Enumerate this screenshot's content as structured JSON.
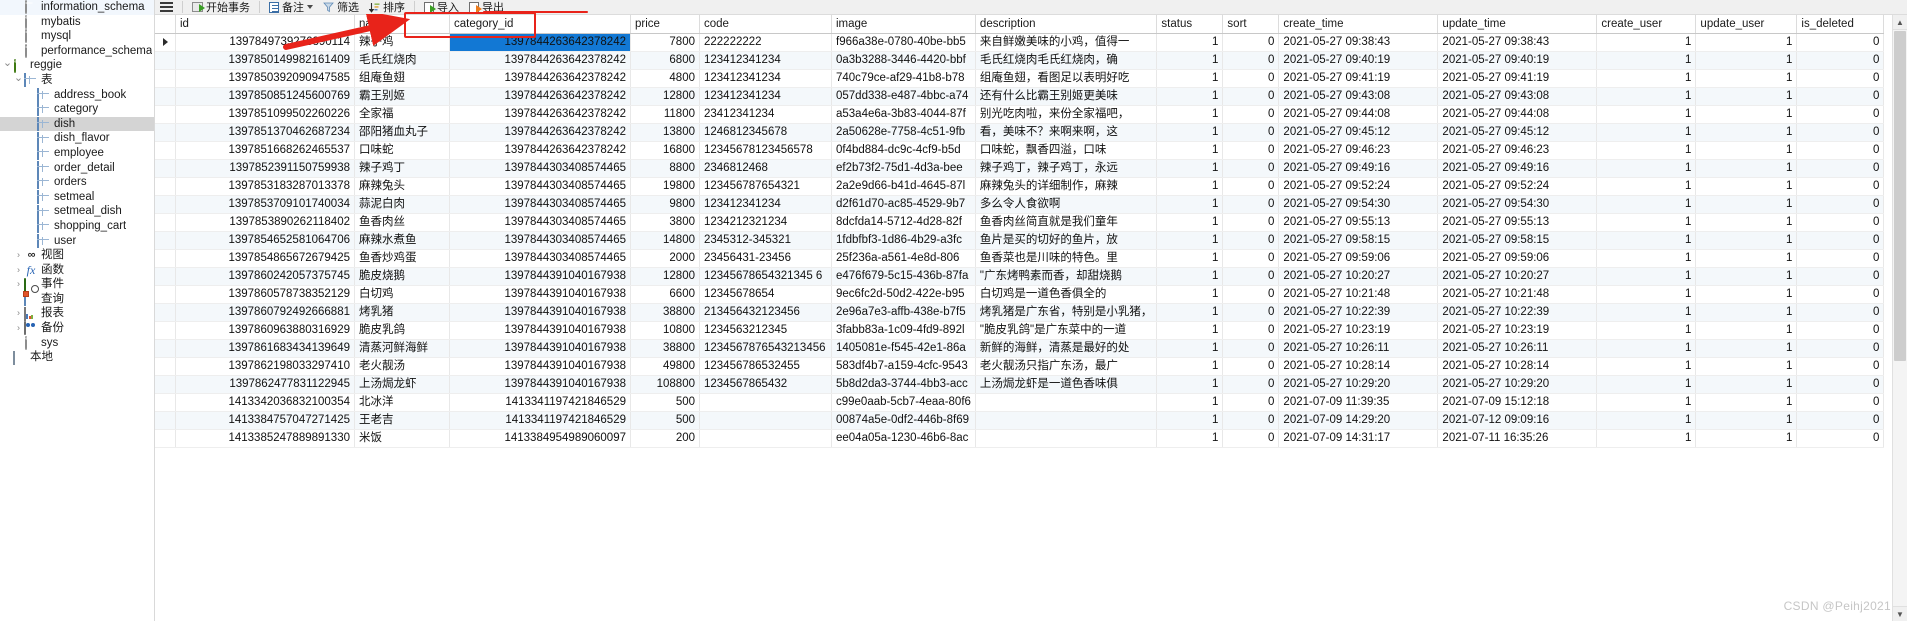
{
  "sidebar": {
    "items": [
      {
        "label": "information_schema",
        "icon": "database-icon",
        "indent": 1,
        "twisty": "",
        "selected": false
      },
      {
        "label": "mybatis",
        "icon": "database-icon",
        "indent": 1,
        "twisty": "",
        "selected": false
      },
      {
        "label": "mysql",
        "icon": "database-icon",
        "indent": 1,
        "twisty": "",
        "selected": false
      },
      {
        "label": "performance_schema",
        "icon": "database-icon",
        "indent": 1,
        "twisty": "",
        "selected": false
      },
      {
        "label": "reggie",
        "icon": "database-green-icon",
        "indent": 0,
        "twisty": "expanded",
        "selected": false
      },
      {
        "label": "表",
        "icon": "table-group-icon",
        "indent": 1,
        "twisty": "expanded",
        "selected": false
      },
      {
        "label": "address_book",
        "icon": "table-icon",
        "indent": 2,
        "twisty": "",
        "selected": false
      },
      {
        "label": "category",
        "icon": "table-icon",
        "indent": 2,
        "twisty": "",
        "selected": false
      },
      {
        "label": "dish",
        "icon": "table-icon",
        "indent": 2,
        "twisty": "",
        "selected": true
      },
      {
        "label": "dish_flavor",
        "icon": "table-icon",
        "indent": 2,
        "twisty": "",
        "selected": false
      },
      {
        "label": "employee",
        "icon": "table-icon",
        "indent": 2,
        "twisty": "",
        "selected": false
      },
      {
        "label": "order_detail",
        "icon": "table-icon",
        "indent": 2,
        "twisty": "",
        "selected": false
      },
      {
        "label": "orders",
        "icon": "table-icon",
        "indent": 2,
        "twisty": "",
        "selected": false
      },
      {
        "label": "setmeal",
        "icon": "table-icon",
        "indent": 2,
        "twisty": "",
        "selected": false
      },
      {
        "label": "setmeal_dish",
        "icon": "table-icon",
        "indent": 2,
        "twisty": "",
        "selected": false
      },
      {
        "label": "shopping_cart",
        "icon": "table-icon",
        "indent": 2,
        "twisty": "",
        "selected": false
      },
      {
        "label": "user",
        "icon": "table-icon",
        "indent": 2,
        "twisty": "",
        "selected": false
      },
      {
        "label": "视图",
        "icon": "view-icon",
        "indent": 1,
        "twisty": "collapsed",
        "selected": false
      },
      {
        "label": "函数",
        "icon": "function-icon",
        "indent": 1,
        "twisty": "collapsed",
        "selected": false
      },
      {
        "label": "事件",
        "icon": "event-icon",
        "indent": 1,
        "twisty": "collapsed",
        "selected": false
      },
      {
        "label": "查询",
        "icon": "query-icon",
        "indent": 1,
        "twisty": "",
        "selected": false
      },
      {
        "label": "报表",
        "icon": "report-icon",
        "indent": 1,
        "twisty": "collapsed",
        "selected": false
      },
      {
        "label": "备份",
        "icon": "backup-icon",
        "indent": 1,
        "twisty": "collapsed",
        "selected": false
      },
      {
        "label": "sys",
        "icon": "database-icon",
        "indent": 1,
        "twisty": "",
        "selected": false
      },
      {
        "label": "本地",
        "icon": "local-icon",
        "indent": 0,
        "twisty": "",
        "selected": false
      }
    ]
  },
  "toolbar": {
    "menu_icon": "hamburger-icon",
    "buttons": [
      {
        "label": "开始事务",
        "icon": "begin-transaction-icon",
        "caret": false
      },
      {
        "label": "备注",
        "icon": "note-icon",
        "caret": true
      },
      {
        "label": "筛选",
        "icon": "filter-icon",
        "caret": false
      },
      {
        "label": "排序",
        "icon": "sort-icon",
        "caret": false
      },
      {
        "label": "导入",
        "icon": "import-icon",
        "caret": false
      },
      {
        "label": "导出",
        "icon": "export-icon",
        "caret": false
      }
    ]
  },
  "grid": {
    "columns": [
      "id",
      "name",
      "category_id",
      "price",
      "code",
      "image",
      "description",
      "status",
      "sort",
      "create_time",
      "update_time",
      "create_user",
      "update_user",
      "is_deleted"
    ],
    "highlighted_column": "category_id",
    "selected_cell": {
      "row": 0,
      "column": "category_id"
    },
    "rows": [
      {
        "id": "1397849739276890114",
        "name": "辣子鸡",
        "category_id": "1397844263642378242",
        "price": "7800",
        "code": "222222222",
        "image": "f966a38e-0780-40be-bb5",
        "description": "来自鲜嫩美味的小鸡，值得一",
        "status": "1",
        "sort": "0",
        "create_time": "2021-05-27 09:38:43",
        "update_time": "2021-05-27 09:38:43",
        "create_user": "1",
        "update_user": "1",
        "is_deleted": "0"
      },
      {
        "id": "1397850149982161409",
        "name": "毛氏红烧肉",
        "category_id": "1397844263642378242",
        "price": "6800",
        "code": "123412341234",
        "image": "0a3b3288-3446-4420-bbf",
        "description": "毛氏红烧肉毛氏红烧肉，确",
        "status": "1",
        "sort": "0",
        "create_time": "2021-05-27 09:40:19",
        "update_time": "2021-05-27 09:40:19",
        "create_user": "1",
        "update_user": "1",
        "is_deleted": "0"
      },
      {
        "id": "1397850392090947585",
        "name": "组庵鱼翅",
        "category_id": "1397844263642378242",
        "price": "4800",
        "code": "123412341234",
        "image": "740c79ce-af29-41b8-b78",
        "description": "组庵鱼翅，看图足以表明好吃",
        "status": "1",
        "sort": "0",
        "create_time": "2021-05-27 09:41:19",
        "update_time": "2021-05-27 09:41:19",
        "create_user": "1",
        "update_user": "1",
        "is_deleted": "0"
      },
      {
        "id": "1397850851245600769",
        "name": "霸王别姬",
        "category_id": "1397844263642378242",
        "price": "12800",
        "code": "123412341234",
        "image": "057dd338-e487-4bbc-a74",
        "description": "还有什么比霸王别姬更美味",
        "status": "1",
        "sort": "0",
        "create_time": "2021-05-27 09:43:08",
        "update_time": "2021-05-27 09:43:08",
        "create_user": "1",
        "update_user": "1",
        "is_deleted": "0"
      },
      {
        "id": "1397851099502260226",
        "name": "全家福",
        "category_id": "1397844263642378242",
        "price": "11800",
        "code": "23412341234",
        "image": "a53a4e6a-3b83-4044-87f",
        "description": "别光吃肉啦，来份全家福吧，",
        "status": "1",
        "sort": "0",
        "create_time": "2021-05-27 09:44:08",
        "update_time": "2021-05-27 09:44:08",
        "create_user": "1",
        "update_user": "1",
        "is_deleted": "0"
      },
      {
        "id": "1397851370462687234",
        "name": "邵阳猪血丸子",
        "category_id": "1397844263642378242",
        "price": "13800",
        "code": "1246812345678",
        "image": "2a50628e-7758-4c51-9fb",
        "description": "看，美味不？来啊来啊，这",
        "status": "1",
        "sort": "0",
        "create_time": "2021-05-27 09:45:12",
        "update_time": "2021-05-27 09:45:12",
        "create_user": "1",
        "update_user": "1",
        "is_deleted": "0"
      },
      {
        "id": "1397851668262465537",
        "name": "口味蛇",
        "category_id": "1397844263642378242",
        "price": "16800",
        "code": "12345678123456578",
        "image": "0f4bd884-dc9c-4cf9-b5d",
        "description": "口味蛇，飘香四溢，口味",
        "status": "1",
        "sort": "0",
        "create_time": "2021-05-27 09:46:23",
        "update_time": "2021-05-27 09:46:23",
        "create_user": "1",
        "update_user": "1",
        "is_deleted": "0"
      },
      {
        "id": "1397852391150759938",
        "name": "辣子鸡丁",
        "category_id": "1397844303408574465",
        "price": "8800",
        "code": "2346812468",
        "image": "ef2b73f2-75d1-4d3a-bee",
        "description": "辣子鸡丁，辣子鸡丁，永远",
        "status": "1",
        "sort": "0",
        "create_time": "2021-05-27 09:49:16",
        "update_time": "2021-05-27 09:49:16",
        "create_user": "1",
        "update_user": "1",
        "is_deleted": "0"
      },
      {
        "id": "1397853183287013378",
        "name": "麻辣兔头",
        "category_id": "1397844303408574465",
        "price": "19800",
        "code": "123456787654321",
        "image": "2a2e9d66-b41d-4645-87l",
        "description": "麻辣兔头的详细制作，麻辣",
        "status": "1",
        "sort": "0",
        "create_time": "2021-05-27 09:52:24",
        "update_time": "2021-05-27 09:52:24",
        "create_user": "1",
        "update_user": "1",
        "is_deleted": "0"
      },
      {
        "id": "1397853709101740034",
        "name": "蒜泥白肉",
        "category_id": "1397844303408574465",
        "price": "9800",
        "code": "123412341234",
        "image": "d2f61d70-ac85-4529-9b7",
        "description": "多么令人食欲啊",
        "status": "1",
        "sort": "0",
        "create_time": "2021-05-27 09:54:30",
        "update_time": "2021-05-27 09:54:30",
        "create_user": "1",
        "update_user": "1",
        "is_deleted": "0"
      },
      {
        "id": "1397853890262118402",
        "name": "鱼香肉丝",
        "category_id": "1397844303408574465",
        "price": "3800",
        "code": "1234212321234",
        "image": "8dcfda14-5712-4d28-82f",
        "description": "鱼香肉丝简直就是我们童年",
        "status": "1",
        "sort": "0",
        "create_time": "2021-05-27 09:55:13",
        "update_time": "2021-05-27 09:55:13",
        "create_user": "1",
        "update_user": "1",
        "is_deleted": "0"
      },
      {
        "id": "1397854652581064706",
        "name": "麻辣水煮鱼",
        "category_id": "1397844303408574465",
        "price": "14800",
        "code": "2345312-345321",
        "image": "1fdbfbf3-1d86-4b29-a3fc",
        "description": "鱼片是买的切好的鱼片，放",
        "status": "1",
        "sort": "0",
        "create_time": "2021-05-27 09:58:15",
        "update_time": "2021-05-27 09:58:15",
        "create_user": "1",
        "update_user": "1",
        "is_deleted": "0"
      },
      {
        "id": "1397854865672679425",
        "name": "鱼香炒鸡蛋",
        "category_id": "1397844303408574465",
        "price": "2000",
        "code": "23456431-23456",
        "image": "25f236a-a561-4e8d-806",
        "description": "鱼香菜也是川味的特色。里",
        "status": "1",
        "sort": "0",
        "create_time": "2021-05-27 09:59:06",
        "update_time": "2021-05-27 09:59:06",
        "create_user": "1",
        "update_user": "1",
        "is_deleted": "0"
      },
      {
        "id": "1397860242057375745",
        "name": "脆皮烧鹅",
        "category_id": "1397844391040167938",
        "price": "12800",
        "code": "12345678654321345 6",
        "image": "e476f679-5c15-436b-87fa",
        "description": "\"广东烤鸭素而香，却甜烧鹅",
        "status": "1",
        "sort": "0",
        "create_time": "2021-05-27 10:20:27",
        "update_time": "2021-05-27 10:20:27",
        "create_user": "1",
        "update_user": "1",
        "is_deleted": "0"
      },
      {
        "id": "1397860578738352129",
        "name": "白切鸡",
        "category_id": "1397844391040167938",
        "price": "6600",
        "code": "12345678654",
        "image": "9ec6fc2d-50d2-422e-b95",
        "description": "白切鸡是一道色香俱全的",
        "status": "1",
        "sort": "0",
        "create_time": "2021-05-27 10:21:48",
        "update_time": "2021-05-27 10:21:48",
        "create_user": "1",
        "update_user": "1",
        "is_deleted": "0"
      },
      {
        "id": "1397860792492666881",
        "name": "烤乳猪",
        "category_id": "1397844391040167938",
        "price": "38800",
        "code": "213456432123456",
        "image": "2e96a7e3-affb-438e-b7f5",
        "description": "烤乳猪是广东省，特别是小乳猪，",
        "status": "1",
        "sort": "0",
        "create_time": "2021-05-27 10:22:39",
        "update_time": "2021-05-27 10:22:39",
        "create_user": "1",
        "update_user": "1",
        "is_deleted": "0"
      },
      {
        "id": "1397860963880316929",
        "name": "脆皮乳鸽",
        "category_id": "1397844391040167938",
        "price": "10800",
        "code": "1234563212345",
        "image": "3fabb83a-1c09-4fd9-892l",
        "description": "\"脆皮乳鸽\"是广东菜中的一道",
        "status": "1",
        "sort": "0",
        "create_time": "2021-05-27 10:23:19",
        "update_time": "2021-05-27 10:23:19",
        "create_user": "1",
        "update_user": "1",
        "is_deleted": "0"
      },
      {
        "id": "1397861683434139649",
        "name": "清蒸河鲜海鲜",
        "category_id": "1397844391040167938",
        "price": "38800",
        "code": "1234567876543213456",
        "image": "1405081e-f545-42e1-86a",
        "description": "新鲜的海鲜，清蒸是最好的处",
        "status": "1",
        "sort": "0",
        "create_time": "2021-05-27 10:26:11",
        "update_time": "2021-05-27 10:26:11",
        "create_user": "1",
        "update_user": "1",
        "is_deleted": "0"
      },
      {
        "id": "1397862198033297410",
        "name": "老火靓汤",
        "category_id": "1397844391040167938",
        "price": "49800",
        "code": "123456786532455",
        "image": "583df4b7-a159-4cfc-9543",
        "description": "老火靓汤只指广东汤，最广",
        "status": "1",
        "sort": "0",
        "create_time": "2021-05-27 10:28:14",
        "update_time": "2021-05-27 10:28:14",
        "create_user": "1",
        "update_user": "1",
        "is_deleted": "0"
      },
      {
        "id": "1397862477831122945",
        "name": "上汤焗龙虾",
        "category_id": "1397844391040167938",
        "price": "108800",
        "code": "1234567865432",
        "image": "5b8d2da3-3744-4bb3-acc",
        "description": "上汤焗龙虾是一道色香味俱",
        "status": "1",
        "sort": "0",
        "create_time": "2021-05-27 10:29:20",
        "update_time": "2021-05-27 10:29:20",
        "create_user": "1",
        "update_user": "1",
        "is_deleted": "0"
      },
      {
        "id": "1413342036832100354",
        "name": "北冰洋",
        "category_id": "1413341197421846529",
        "price": "500",
        "code": "",
        "image": "c99e0aab-5cb7-4eaa-80f6",
        "description": "",
        "status": "1",
        "sort": "0",
        "create_time": "2021-07-09 11:39:35",
        "update_time": "2021-07-09 15:12:18",
        "create_user": "1",
        "update_user": "1",
        "is_deleted": "0"
      },
      {
        "id": "1413384757047271425",
        "name": "王老吉",
        "category_id": "1413341197421846529",
        "price": "500",
        "code": "",
        "image": "00874a5e-0df2-446b-8f69",
        "description": "",
        "status": "1",
        "sort": "0",
        "create_time": "2021-07-09 14:29:20",
        "update_time": "2021-07-12 09:09:16",
        "create_user": "1",
        "update_user": "1",
        "is_deleted": "0"
      },
      {
        "id": "1413385247889891330",
        "name": "米饭",
        "category_id": "1413384954989060097",
        "price": "200",
        "code": "",
        "image": "ee04a05a-1230-46b6-8ac",
        "description": "",
        "status": "1",
        "sort": "0",
        "create_time": "2021-07-09 14:31:17",
        "update_time": "2021-07-11 16:35:26",
        "create_user": "1",
        "update_user": "1",
        "is_deleted": "0"
      }
    ]
  },
  "annotations": {
    "highlight_box_label": "category_id",
    "arrow_label": "points-to-category-id-column"
  },
  "watermark": {
    "text": "CSDN @Peihj2021"
  },
  "colors": {
    "accent_red": "#e8231a",
    "selection_blue": "#1278d4",
    "header_bg": "#f0f0f0",
    "alt_row": "#f4f8fb"
  }
}
